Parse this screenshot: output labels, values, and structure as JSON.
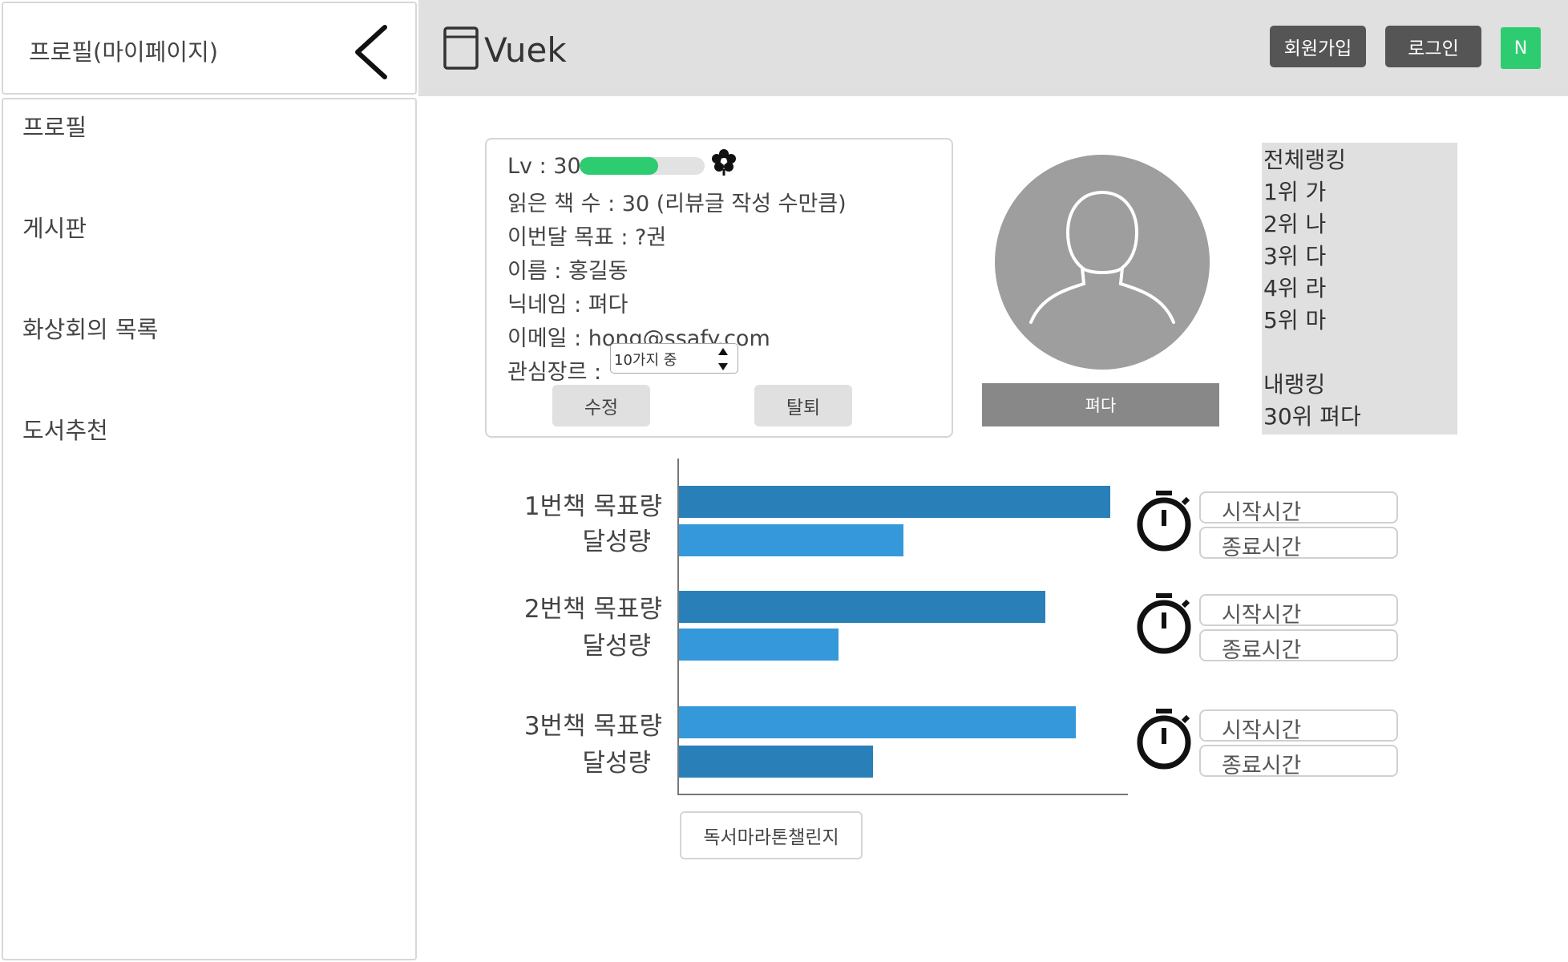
{
  "sidebar": {
    "title": "프로필(마이페이지)",
    "items": [
      {
        "label": "프로필"
      },
      {
        "label": "게시판"
      },
      {
        "label": "화상회의 목록"
      },
      {
        "label": "도서추천"
      }
    ]
  },
  "header": {
    "logo_text": "Vuek",
    "signup_label": "회원가입",
    "login_label": "로그인",
    "user_initial": "N"
  },
  "profile": {
    "level_label": "Lv : 30",
    "level_progress": 0.63,
    "books_read": "읽은 책 수 : 30 (리뷰글 작성 수만큼)",
    "monthly_goal": "이번달 목표 : ?권",
    "name": "이름 : 홍길동",
    "nickname": "닉네임 : 펴다",
    "email": "이메일 : hong@ssafy.com",
    "genre_label": "관심장르 :",
    "genre_value": "10가지 중",
    "edit_label": "수정",
    "withdraw_label": "탈퇴",
    "display_name": "펴다"
  },
  "ranking": {
    "title": "전체랭킹",
    "entries": [
      "1위 가",
      "2위 나",
      "3위 다",
      "4위 라",
      "5위 마"
    ],
    "my_title": "내랭킹",
    "my_rank": "30위 펴다"
  },
  "chart_data": {
    "type": "bar",
    "orientation": "horizontal",
    "groups": [
      {
        "goal_label": "1번책 목표량",
        "done_label": "달성량",
        "goal": 1.0,
        "done": 0.52
      },
      {
        "goal_label": "2번책 목표량",
        "done_label": "달성량",
        "goal": 0.85,
        "done": 0.37
      },
      {
        "goal_label": "3번책 목표량",
        "done_label": "달성량",
        "goal": 0.92,
        "done": 0.45
      }
    ]
  },
  "timers": [
    {
      "start_placeholder": "시작시간",
      "end_placeholder": "종료시간"
    },
    {
      "start_placeholder": "시작시간",
      "end_placeholder": "종료시간"
    },
    {
      "start_placeholder": "시작시간",
      "end_placeholder": "종료시간"
    }
  ],
  "challenge_label": "독서마라톤챌린지",
  "colors": {
    "accent_green": "#2ecc71",
    "bar_dark": "#2980b9",
    "bar_light": "#3498db",
    "button_dark": "#555555"
  }
}
